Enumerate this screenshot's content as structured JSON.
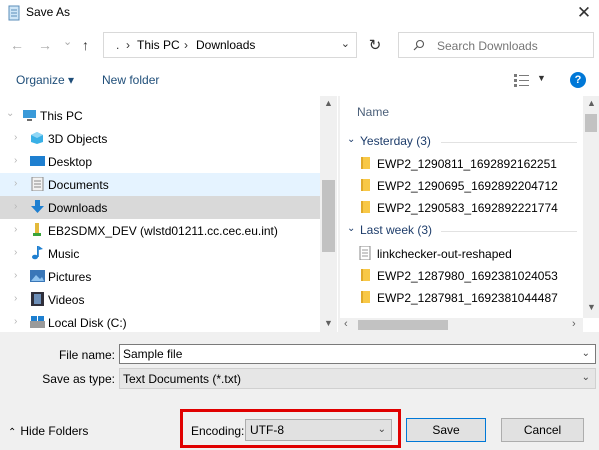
{
  "window": {
    "title": "Save As",
    "close_glyph": "✕"
  },
  "nav_buttons": {
    "back": "←",
    "forward": "→",
    "recent": "⌄",
    "up": "↑"
  },
  "address": {
    "crumbs": [
      "This PC",
      "Downloads"
    ],
    "separator": "›",
    "leading": ".",
    "dropdown": "⌄"
  },
  "refresh_glyph": "↻",
  "search": {
    "placeholder": "Search Downloads"
  },
  "toolbar": {
    "organize": "Organize ▾",
    "new_folder": "New folder",
    "view_dropdown": "▼",
    "help": "?"
  },
  "nav_pane": {
    "items": [
      {
        "label": "This PC",
        "icon": "pc-icon",
        "state": ""
      },
      {
        "label": "3D Objects",
        "icon": "3d-objects-icon",
        "state": ""
      },
      {
        "label": "Desktop",
        "icon": "desktop-icon",
        "state": ""
      },
      {
        "label": "Documents",
        "icon": "documents-icon",
        "state": "hover"
      },
      {
        "label": "Downloads",
        "icon": "downloads-icon",
        "state": "selected"
      },
      {
        "label": "EB2SDMX_DEV (wlstd01211.cc.cec.eu.int)",
        "icon": "network-drive-icon",
        "state": ""
      },
      {
        "label": "Music",
        "icon": "music-icon",
        "state": ""
      },
      {
        "label": "Pictures",
        "icon": "pictures-icon",
        "state": ""
      },
      {
        "label": "Videos",
        "icon": "videos-icon",
        "state": ""
      },
      {
        "label": "Local Disk (C:)",
        "icon": "local-disk-icon",
        "state": ""
      }
    ]
  },
  "file_pane": {
    "column_header": "Name",
    "groups": [
      {
        "label": "Yesterday (3)",
        "files": [
          {
            "name": "EWP2_1290811_1692892162251",
            "icon": "folder-icon"
          },
          {
            "name": "EWP2_1290695_1692892204712",
            "icon": "folder-icon"
          },
          {
            "name": "EWP2_1290583_1692892221774",
            "icon": "folder-icon"
          }
        ]
      },
      {
        "label": "Last week (3)",
        "files": [
          {
            "name": "linkchecker-out-reshaped",
            "icon": "text-file-icon"
          },
          {
            "name": "EWP2_1287980_1692381024053",
            "icon": "folder-icon"
          },
          {
            "name": "EWP2_1287981_1692381044487",
            "icon": "folder-icon"
          }
        ]
      }
    ]
  },
  "form": {
    "file_name_label": "File name:",
    "file_name_value": "Sample file",
    "save_as_type_label": "Save as type:",
    "save_as_type_value": "Text Documents (*.txt)"
  },
  "footer": {
    "hide_folders": "Hide Folders",
    "encoding_label": "Encoding:",
    "encoding_value": "UTF-8",
    "save": "Save",
    "cancel": "Cancel"
  },
  "colors": {
    "accent": "#0078d7",
    "highlight": "#e00000",
    "folder": "#f8c846",
    "link": "#1f4e79"
  }
}
